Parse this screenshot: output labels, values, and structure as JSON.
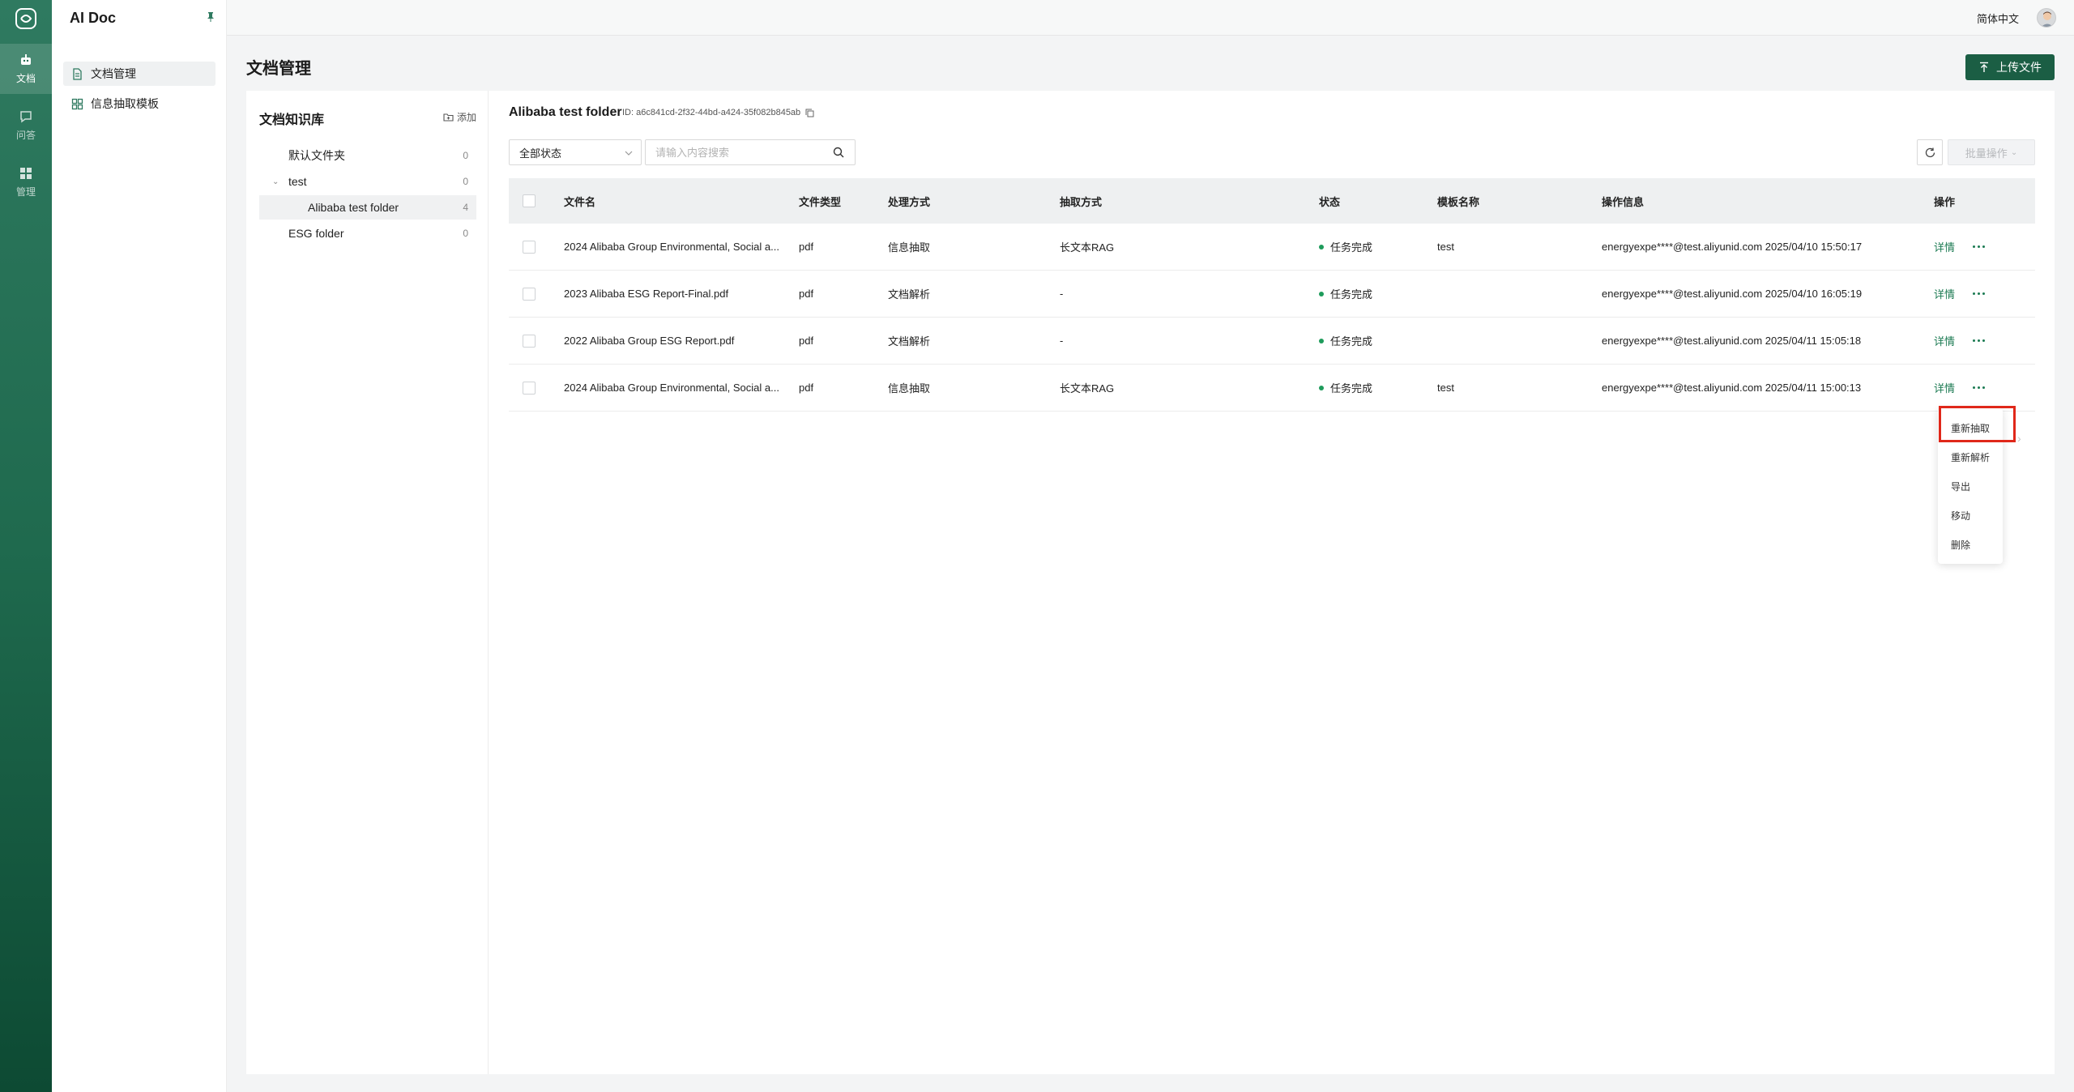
{
  "app": {
    "title": "AI Doc"
  },
  "rail": {
    "items": [
      {
        "label": "文档",
        "icon": "robot-icon",
        "active": true
      },
      {
        "label": "问答",
        "icon": "chat-icon",
        "active": false
      },
      {
        "label": "管理",
        "icon": "grid-icon",
        "active": false
      }
    ]
  },
  "sidebar": {
    "items": [
      {
        "label": "文档管理",
        "icon": "document-icon",
        "active": true
      },
      {
        "label": "信息抽取模板",
        "icon": "template-grid-icon",
        "active": false
      }
    ]
  },
  "topbar": {
    "language": "简体中文"
  },
  "page": {
    "title": "文档管理",
    "upload_label": "上传文件"
  },
  "kb": {
    "title": "文档知识库",
    "add_label": "添加",
    "tree": [
      {
        "label": "默认文件夹",
        "count": "0",
        "level": 0
      },
      {
        "label": "test",
        "count": "0",
        "level": 0,
        "expanded": true
      },
      {
        "label": "Alibaba test folder",
        "count": "4",
        "level": 1,
        "active": true
      },
      {
        "label": "ESG folder",
        "count": "0",
        "level": 0
      }
    ]
  },
  "folder": {
    "name": "Alibaba test folder",
    "id_text": "ID: a6c841cd-2f32-44bd-a424-35f082b845ab"
  },
  "filters": {
    "status_value": "全部状态",
    "search_placeholder": "请输入内容搜索",
    "batch_label": "批量操作"
  },
  "table": {
    "headers": [
      "文件名",
      "文件类型",
      "处理方式",
      "抽取方式",
      "状态",
      "模板名称",
      "操作信息",
      "操作"
    ],
    "rows": [
      {
        "name": "2024 Alibaba Group Environmental, Social a...",
        "type": "pdf",
        "process": "信息抽取",
        "extract": "长文本RAG",
        "status": "任务完成",
        "template": "test",
        "info": "energyexpe****@test.aliyunid.com 2025/04/10 15:50:17",
        "action": "详情"
      },
      {
        "name": "2023 Alibaba ESG Report-Final.pdf",
        "type": "pdf",
        "process": "文档解析",
        "extract": "-",
        "status": "任务完成",
        "template": "",
        "info": "energyexpe****@test.aliyunid.com 2025/04/10 16:05:19",
        "action": "详情"
      },
      {
        "name": "2022 Alibaba Group ESG Report.pdf",
        "type": "pdf",
        "process": "文档解析",
        "extract": "-",
        "status": "任务完成",
        "template": "",
        "info": "energyexpe****@test.aliyunid.com 2025/04/11 15:05:18",
        "action": "详情"
      },
      {
        "name": "2024 Alibaba Group Environmental, Social a...",
        "type": "pdf",
        "process": "信息抽取",
        "extract": "长文本RAG",
        "status": "任务完成",
        "template": "test",
        "info": "energyexpe****@test.aliyunid.com 2025/04/11 15:00:13",
        "action": "详情"
      }
    ]
  },
  "menu": {
    "items": [
      "重新抽取",
      "重新解析",
      "导出",
      "移动",
      "删除"
    ]
  },
  "colors": {
    "brand": "#1b5e44",
    "link": "#1b7a52",
    "status_ok": "#1e9b5b",
    "highlight": "#e0281a"
  }
}
